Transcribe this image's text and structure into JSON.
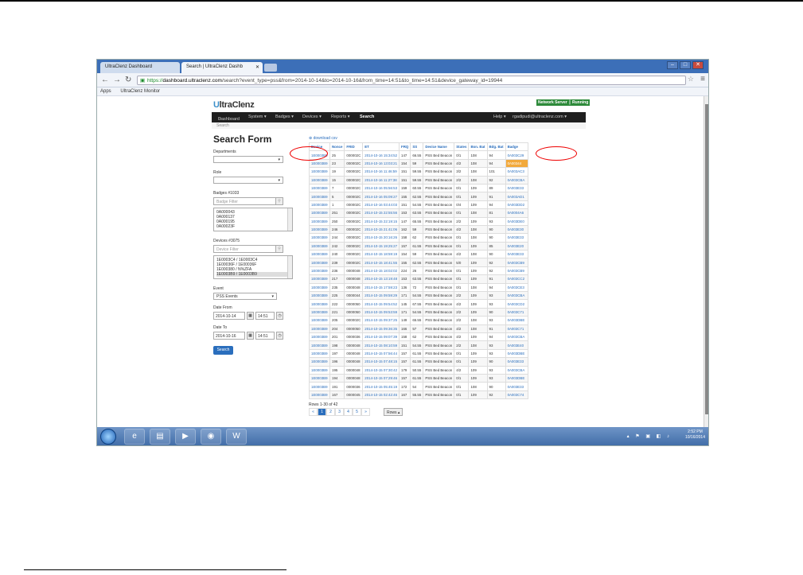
{
  "browser": {
    "tabs": [
      {
        "label": "UltraClenz Dashboard"
      },
      {
        "label": "Search | UltraClenz Dashb"
      }
    ],
    "url_https": "https://",
    "url_host": "dashboard.ultraclenz.com",
    "url_path": "/search?event_type=pss&from=2014-10-14&to=2014-10-16&from_time=14:51&to_time=14:51&device_gateway_id=19944",
    "bookmarks": [
      "Apps",
      "UltraClenz Monitor"
    ]
  },
  "app": {
    "logo_prefix": "U",
    "logo_rest": "ltraClenz",
    "network_status": "Network Server ║ Running",
    "nav": {
      "dashboard": "Dashboard",
      "system": "System ▾",
      "badges": "Badges ▾",
      "devices": "Devices ▾",
      "reports": "Reports ▾",
      "search": "Search",
      "help": "Help ▾",
      "user": "rgadipudi@ultraclenz.com ▾"
    },
    "breadcrumb": "Search"
  },
  "form": {
    "title": "Search Form",
    "departments_label": "Departments",
    "role_label": "Role",
    "badges_label": "Badges #1033",
    "badge_filter_placeholder": "Badge Filter",
    "badge_items": [
      "0A000043",
      "0A000137",
      "0A000195",
      "0A00023F"
    ],
    "devices_label": "Devices #3075",
    "device_filter_placeholder": "Device Filter",
    "device_items": [
      "1E0003C4 / 1E0003C4",
      "1E00036F / 1E00036F",
      "1E000380 / N%ZFA",
      "1E0003B9 / 1E0003B9"
    ],
    "event_label": "Event",
    "event_value": "PSS Events",
    "date_from_label": "Date From",
    "date_from": "2014-10-14",
    "time_from": "14:51",
    "date_to_label": "Date To",
    "date_to": "2014-10-16",
    "time_to": "14:51",
    "search_button": "Search"
  },
  "results": {
    "download_csv": "download csv",
    "headers": [
      "Device",
      "Nonce",
      "FRID",
      "ET",
      "FRQ",
      "SS",
      "Device Name",
      "States",
      "Bon. Bat",
      "Bdg. Bat",
      "Badge"
    ],
    "rows": [
      [
        "1E0003B9",
        "25",
        "000002C",
        "2014-10-16 15:34:52",
        "147",
        "66.55",
        "PSS Bed Beacon",
        "0/1",
        "108",
        "94",
        "0A003C29"
      ],
      [
        "1E0003B9",
        "23",
        "000002C",
        "2014-10-16 13:03:21",
        "154",
        "59",
        "PSS Bed Beacon",
        "4/2",
        "108",
        "94",
        "0A00344"
      ],
      [
        "1E0003B9",
        "19",
        "000002C",
        "2014-10-16 11:46:59",
        "151",
        "59.55",
        "PSS Bed Beacon",
        "3/2",
        "108",
        "101",
        "0A003AC3"
      ],
      [
        "1E0003B9",
        "15",
        "000002C",
        "2014-10-16 11:27:38",
        "151",
        "59.55",
        "PSS Bed Beacon",
        "2/2",
        "108",
        "92",
        "0A003CBA"
      ],
      [
        "1E0003B9",
        "7",
        "000002C",
        "2014-10-16 05:56:53",
        "159",
        "60.55",
        "PSS Bed Beacon",
        "0/1",
        "109",
        "89",
        "0A003E33"
      ],
      [
        "1E0003B9",
        "5",
        "000002C",
        "2014-10-16 05:09:27",
        "155",
        "62.55",
        "PSS Bed Beacon",
        "0/1",
        "109",
        "91",
        "0A003AD1"
      ],
      [
        "1E0003B9",
        "1",
        "000002C",
        "2014-10-16 03:44:03",
        "151",
        "54.55",
        "PSS Bed Beacon",
        "0/4",
        "109",
        "94",
        "0A003DD2"
      ],
      [
        "1E0003B9",
        "251",
        "000002C",
        "2014-10-15 22:55:56",
        "153",
        "63.55",
        "PSS Bed Beacon",
        "0/1",
        "108",
        "81",
        "0A0004A6"
      ],
      [
        "1E0003B9",
        "250",
        "000002C",
        "2014-10-15 22:19:15",
        "147",
        "65.55",
        "PSS Bed Beacon",
        "2/2",
        "109",
        "93",
        "0A003DE0"
      ],
      [
        "1E0003B9",
        "246",
        "000002C",
        "2014-10-15 21:41:06",
        "162",
        "59",
        "PSS Bed Beacon",
        "4/2",
        "108",
        "90",
        "0A003E30"
      ],
      [
        "1E0003B9",
        "244",
        "000002C",
        "2014-10-15 20:16:26",
        "158",
        "62",
        "PSS Bed Beacon",
        "0/1",
        "108",
        "90",
        "0A003E33"
      ],
      [
        "1E0003B9",
        "242",
        "000002C",
        "2014-10-15 19:25:27",
        "157",
        "61.55",
        "PSS Bed Beacon",
        "0/1",
        "109",
        "85",
        "0A003E20"
      ],
      [
        "1E0003B9",
        "240",
        "000002C",
        "2014-10-15 18:59:19",
        "154",
        "59",
        "PSS Bed Beacon",
        "4/2",
        "108",
        "90",
        "0A003E33"
      ],
      [
        "1E0003B9",
        "239",
        "000002C",
        "2014-10-15 18:41:55",
        "155",
        "62.55",
        "PSS Bed Beacon",
        "5/0",
        "109",
        "92",
        "0A003CB9"
      ],
      [
        "1E0003B9",
        "236",
        "0000048",
        "2014-10-15 18:02:02",
        "224",
        "26",
        "PSS Bed Beacon",
        "0/1",
        "109",
        "92",
        "0A003CB9"
      ],
      [
        "1E0003B9",
        "217",
        "0000048",
        "2014-10-15 13:19:48",
        "153",
        "63.55",
        "PSS Bed Beacon",
        "0/1",
        "109",
        "91",
        "0A003CC2"
      ],
      [
        "1E0003B9",
        "235",
        "0000048",
        "2014-10-15 17:59:23",
        "136",
        "72",
        "PSS Bed Beacon",
        "0/1",
        "108",
        "94",
        "0A003CE3"
      ],
      [
        "1E0003B9",
        "225",
        "0000044",
        "2014-10-15 09:59:29",
        "171",
        "54.55",
        "PSS Bed Beacon",
        "2/2",
        "109",
        "93",
        "0A003CBA"
      ],
      [
        "1E0003B9",
        "222",
        "0000050",
        "2014-10-15 09:54:52",
        "145",
        "67.55",
        "PSS Bed Beacon",
        "4/2",
        "109",
        "93",
        "0A003CD2"
      ],
      [
        "1E0003B9",
        "221",
        "0000050",
        "2014-10-15 09:53:59",
        "171",
        "54.55",
        "PSS Bed Beacon",
        "2/2",
        "109",
        "90",
        "0A003C71"
      ],
      [
        "1E0003B9",
        "205",
        "000002C",
        "2014-10-15 09:37:25",
        "149",
        "65.55",
        "PSS Bed Beacon",
        "2/2",
        "108",
        "93",
        "0A003DBE"
      ],
      [
        "1E0003B9",
        "204",
        "0000050",
        "2014-10-15 09:36:35",
        "166",
        "57",
        "PSS Bed Beacon",
        "4/2",
        "108",
        "91",
        "0A003C71"
      ],
      [
        "1E0003B9",
        "201",
        "0000036",
        "2014-10-15 09:07:39",
        "158",
        "62",
        "PSS Bed Beacon",
        "4/2",
        "109",
        "94",
        "0A003CBA"
      ],
      [
        "1E0003B9",
        "198",
        "0000048",
        "2014-10-15 08:10:59",
        "151",
        "54.55",
        "PSS Bed Beacon",
        "2/2",
        "108",
        "93",
        "0A003E40"
      ],
      [
        "1E0003B9",
        "197",
        "0000048",
        "2014-10-15 07:56:44",
        "157",
        "61.55",
        "PSS Bed Beacon",
        "0/1",
        "109",
        "93",
        "0A003DBE"
      ],
      [
        "1E0003B9",
        "196",
        "0000048",
        "2014-10-15 07:48:15",
        "157",
        "61.55",
        "PSS Bed Beacon",
        "0/1",
        "109",
        "90",
        "0A003E33"
      ],
      [
        "1E0003B9",
        "195",
        "0000048",
        "2014-10-15 07:30:42",
        "179",
        "50.55",
        "PSS Bed Beacon",
        "4/2",
        "109",
        "93",
        "0A003CBA"
      ],
      [
        "1E0003B9",
        "194",
        "0000048",
        "2014-10-15 07:29:46",
        "157",
        "61.55",
        "PSS Bed Beacon",
        "0/1",
        "109",
        "93",
        "0A003DBE"
      ],
      [
        "1E0003B9",
        "191",
        "0000036",
        "2014-10-15 05:45:19",
        "172",
        "54",
        "PSS Bed Beacon",
        "0/1",
        "108",
        "90",
        "0A003E33"
      ],
      [
        "1E0003B9",
        "167",
        "0000045",
        "2014-10-15 02:42:46",
        "167",
        "55.55",
        "PSS Bed Beacon",
        "0/1",
        "109",
        "92",
        "0A003C74"
      ]
    ],
    "rows_info": "Rows 1-30 of 42",
    "pager": [
      "«",
      "1",
      "2",
      "3",
      "4",
      "5",
      "»"
    ],
    "rows_button": "Rows ▴"
  },
  "taskbar": {
    "time": "2:52 PM",
    "date": "10/16/2014"
  },
  "colors": {
    "accent": "#2a6ebd",
    "tabbar": "#3c6fb8",
    "annotation": "#e00000",
    "badge_highlight": "#f2a93b"
  },
  "icons": [
    "home-icon",
    "search-icon",
    "calendar-icon",
    "clock-icon",
    "chrome-icon",
    "ie-icon",
    "word-icon"
  ]
}
